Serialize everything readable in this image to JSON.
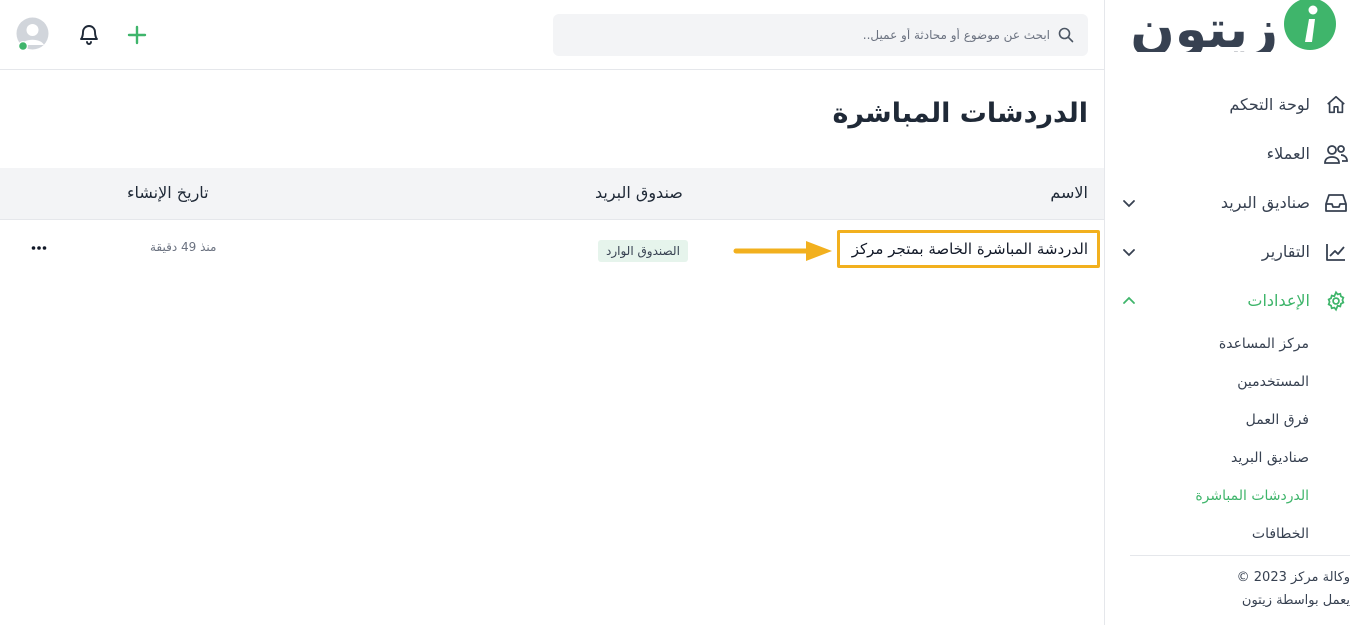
{
  "brand": {
    "name": "زيتون",
    "colors": {
      "accent": "#3fb56b",
      "highlight": "#f2b01e"
    }
  },
  "topbar": {
    "search": {
      "placeholder": "ابحث عن موضوع أو محادثة أو عميل..",
      "icon": "search-icon"
    },
    "icons": [
      "avatar",
      "bell-icon",
      "plus-icon"
    ],
    "user_status": "online"
  },
  "sidebar": {
    "items": [
      {
        "label": "لوحة التحكم",
        "icon": "home-icon"
      },
      {
        "label": "العملاء",
        "icon": "users-icon"
      },
      {
        "label": "صناديق البريد",
        "icon": "inbox-icon",
        "expandable": true
      },
      {
        "label": "التقارير",
        "icon": "chart-icon",
        "expandable": true
      },
      {
        "label": "الإعدادات",
        "icon": "gear-icon",
        "expanded": true,
        "active": true
      }
    ],
    "settings_sub": [
      {
        "label": "مركز المساعدة"
      },
      {
        "label": "المستخدمين"
      },
      {
        "label": "فرق العمل"
      },
      {
        "label": "صناديق البريد"
      },
      {
        "label": "الدردشات المباشرة",
        "active": true
      },
      {
        "label": "الخطافات"
      }
    ],
    "footer": {
      "copyright": "© 2023 وكالة مركز",
      "powered": "يعمل بواسطة زيتون"
    }
  },
  "main": {
    "title": "الدردشات المباشرة",
    "columns": {
      "name": "الاسم",
      "inbox": "صندوق البريد",
      "created": "تاريخ الإنشاء"
    },
    "rows": [
      {
        "name": "الدردشة المباشرة الخاصة بمتجر مركز",
        "inbox": "الصندوق الوارد",
        "created": "منذ 49 دقيقة",
        "actions": "..."
      }
    ]
  }
}
